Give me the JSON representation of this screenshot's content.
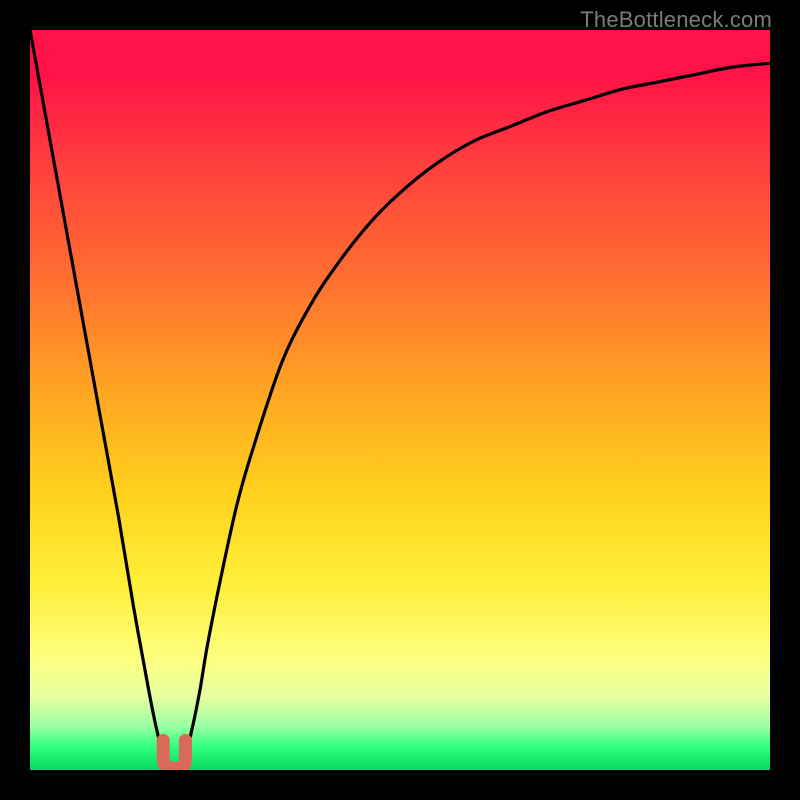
{
  "watermark": "TheBottleneck.com",
  "colors": {
    "frame": "#000000",
    "curve": "#000000",
    "trough_marker": "#d96a5a",
    "gradient_top": "#ff1247",
    "gradient_bottom": "#06d761"
  },
  "chart_data": {
    "type": "line",
    "title": "",
    "xlabel": "",
    "ylabel": "",
    "xlim": [
      0,
      100
    ],
    "ylim": [
      0,
      100
    ],
    "grid": false,
    "legend": false,
    "annotations": [],
    "series": [
      {
        "name": "bottleneck-curve",
        "x": [
          0,
          2,
          4,
          6,
          8,
          10,
          12,
          14,
          16,
          17,
          18,
          19,
          20,
          21,
          22,
          23,
          24,
          26,
          28,
          30,
          34,
          38,
          42,
          46,
          50,
          55,
          60,
          65,
          70,
          75,
          80,
          85,
          90,
          95,
          100
        ],
        "y": [
          100,
          89,
          78,
          67,
          56,
          45,
          34,
          22,
          11,
          6,
          2,
          0,
          0,
          2,
          6,
          11,
          17,
          27,
          36,
          43,
          55,
          63,
          69,
          74,
          78,
          82,
          85,
          87,
          89,
          90.5,
          92,
          93,
          94,
          95,
          95.5
        ]
      }
    ],
    "trough_x": 19.5,
    "trough_marker_width": 3,
    "trough_marker_height": 4,
    "background": "vertical-gradient red→green"
  }
}
